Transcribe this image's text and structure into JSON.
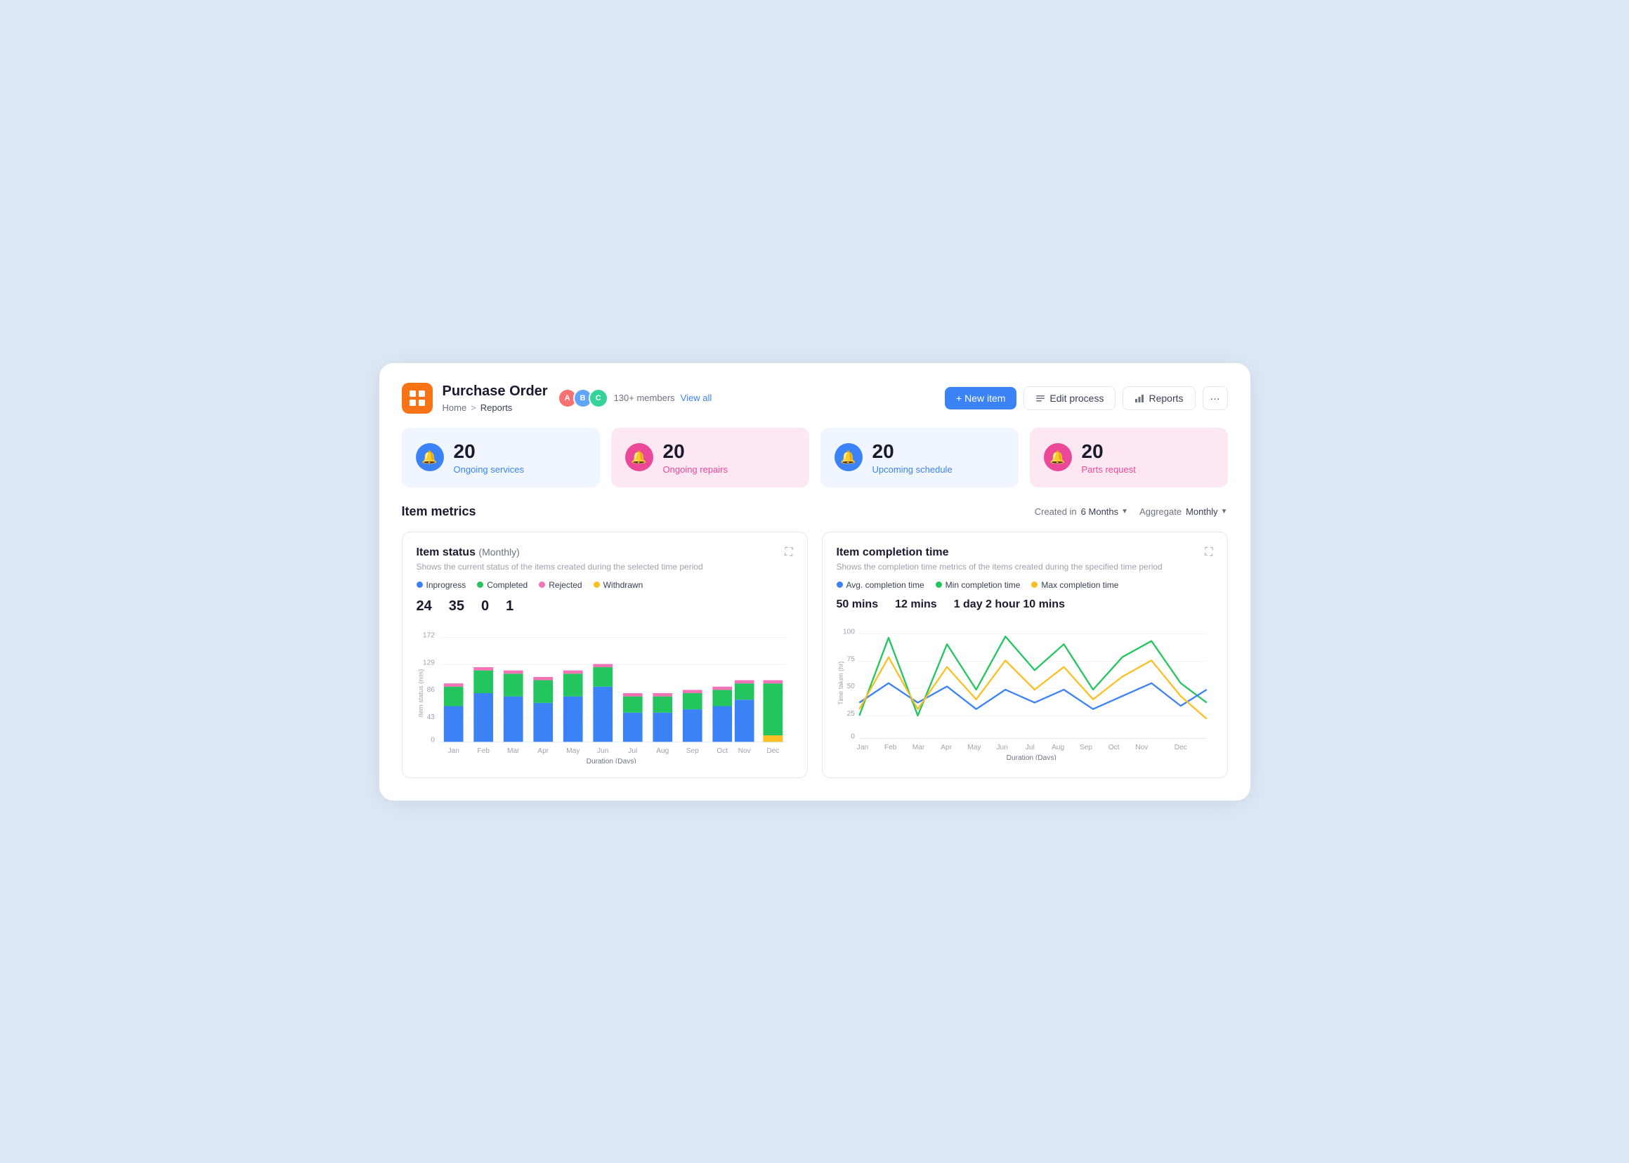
{
  "app": {
    "icon_color": "#f97316",
    "title": "Purchase Order",
    "members_count": "130+ members",
    "view_all_label": "View all"
  },
  "breadcrumb": {
    "home": "Home",
    "separator": ">",
    "current": "Reports"
  },
  "header_buttons": {
    "new_item": "+ New item",
    "edit_process": "Edit process",
    "reports": "Reports"
  },
  "stat_cards": [
    {
      "number": "20",
      "label": "Ongoing services",
      "variant": "blue"
    },
    {
      "number": "20",
      "label": "Ongoing repairs",
      "variant": "pink"
    },
    {
      "number": "20",
      "label": "Upcoming schedule",
      "variant": "blue"
    },
    {
      "number": "20",
      "label": "Parts request",
      "variant": "pink"
    }
  ],
  "metrics": {
    "title": "Item metrics",
    "created_in_label": "Created in",
    "created_in_value": "6 Months",
    "aggregate_label": "Aggregate",
    "aggregate_value": "Monthly"
  },
  "item_status_chart": {
    "title": "Item status",
    "period": "(Monthly)",
    "subtitle": "Shows the current status of the items created during the selected time period",
    "legend": [
      {
        "label": "Inprogress",
        "color": "#3b82f6",
        "value": "24"
      },
      {
        "label": "Completed",
        "color": "#22c55e",
        "value": "35"
      },
      {
        "label": "Rejected",
        "color": "#f472b6",
        "value": "0"
      },
      {
        "label": "Withdrawn",
        "color": "#fbbf24",
        "value": "1"
      }
    ],
    "y_axis_label": "Item status (nos)",
    "x_axis_label": "Duration (Days)",
    "y_ticks": [
      "172",
      "129",
      "86",
      "43",
      "0"
    ],
    "x_ticks": [
      "Jan",
      "Feb",
      "Mar",
      "Apr",
      "May",
      "Jun",
      "Jul",
      "Aug",
      "Sep",
      "Oct",
      "Nov",
      "Dec"
    ]
  },
  "completion_time_chart": {
    "title": "Item completion time",
    "subtitle": "Shows the completion time metrics of the items created during the specified time period",
    "legend": [
      {
        "label": "Avg. completion time",
        "color": "#3b82f6",
        "value": "50 mins"
      },
      {
        "label": "Min completion time",
        "color": "#22c55e",
        "value": "12 mins"
      },
      {
        "label": "Max completion time",
        "color": "#fbbf24",
        "value": "1 day 2 hour 10 mins"
      }
    ],
    "y_axis_label": "Time taken (hr)",
    "x_axis_label": "Duration (Days)",
    "y_ticks": [
      "100",
      "75",
      "50",
      "25",
      "0"
    ],
    "x_ticks": [
      "Jan",
      "Feb",
      "Mar",
      "Apr",
      "May",
      "Jun",
      "Jul",
      "Aug",
      "Sep",
      "Oct",
      "Nov",
      "Dec"
    ]
  }
}
